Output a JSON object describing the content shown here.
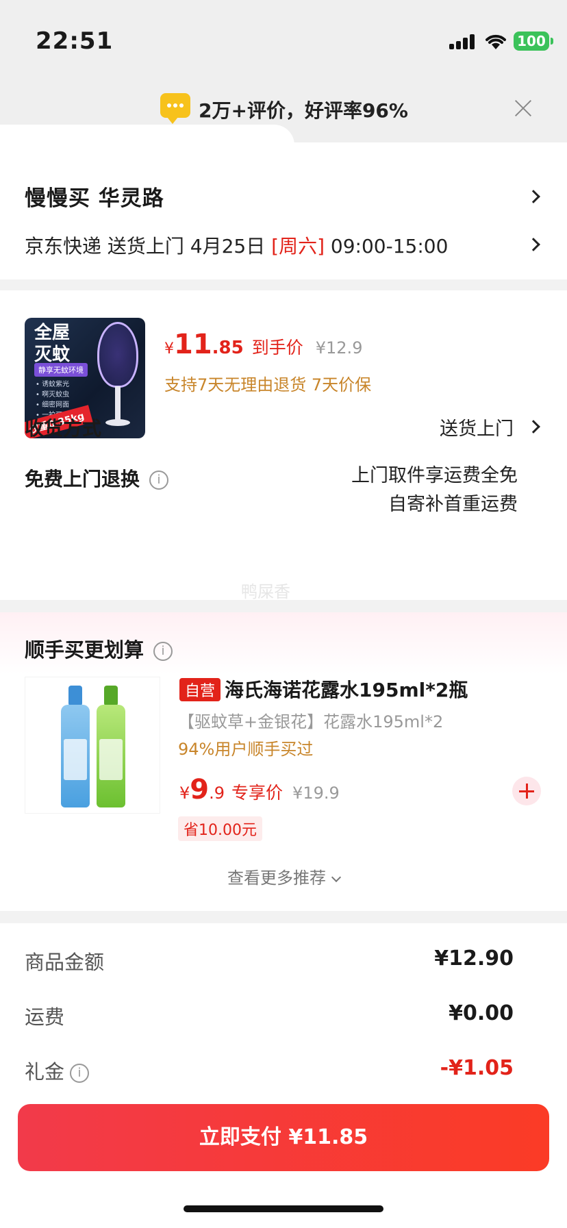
{
  "status": {
    "time": "22:51",
    "battery": "100"
  },
  "banner": {
    "text": "2万+评价，好评率96%"
  },
  "address": {
    "name": "慢慢买  华灵路",
    "carrier": "京东快递 送货上门 4月25日 ",
    "weekday": "[周六]",
    "time_window": " 09:00-15:00"
  },
  "product": {
    "thumb": {
      "line1": "全屋",
      "line2": "灭蚊",
      "tag": "静享无蚊环境",
      "feats": "• 诱蚊紫光\n• 啊灭蚊虫\n• 细密网面\n• 一拍两用",
      "weight": "仅重0.35kg"
    },
    "price_symbol": "¥",
    "price_int": "11",
    "price_dec": ".85",
    "price_label": "到手价",
    "original_price": "¥12.9",
    "services": "支持7天无理由退货  7天价保"
  },
  "delivery_method": {
    "label": "收货方式",
    "value": "送货上门"
  },
  "free_return": {
    "label": "免费上门退换",
    "line1": "上门取件享运费全免",
    "line2": "自寄补首重运费"
  },
  "watermark": "鸭屎香",
  "recommend": {
    "title": "顺手买更划算",
    "tag": "自营",
    "name": "海氏海诺花露水195ml*2瓶",
    "subtitle": "【驱蚊草+金银花】花露水195ml*2",
    "bought": "94%用户顺手买过",
    "price_symbol": "¥",
    "price_int": "9",
    "price_dec": ".9",
    "price_label": "专享价",
    "original_price": "¥19.9",
    "save": "省10.00元",
    "more": "查看更多推荐"
  },
  "summary": {
    "goods_label": "商品金额",
    "goods_value": "¥12.90",
    "shipping_label": "运费",
    "shipping_value": "¥0.00",
    "gift_label": "礼金",
    "gift_value": "-¥1.05"
  },
  "pay_button": "立即支付 ¥11.85",
  "colors": {
    "accent": "#e2231a",
    "gold": "#c8852a",
    "pay_gradient_start": "#f23a4a",
    "pay_gradient_end": "#fb3b26"
  }
}
